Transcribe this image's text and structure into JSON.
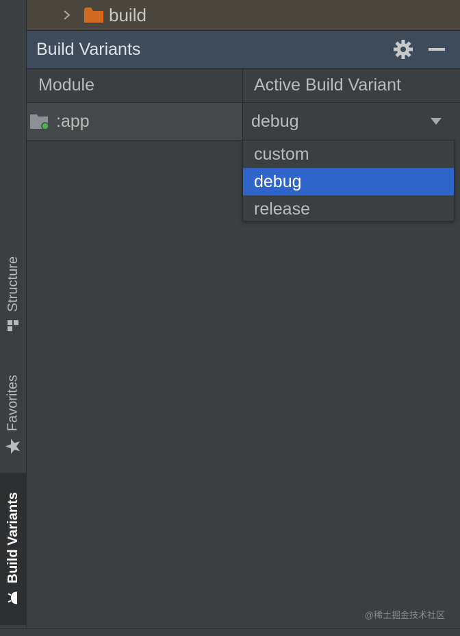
{
  "project_tree": {
    "folder_label": "build"
  },
  "panel": {
    "title": "Build Variants"
  },
  "table": {
    "columns": [
      "Module",
      "Active Build Variant"
    ],
    "rows": [
      {
        "module": ":app",
        "variant": "debug"
      }
    ]
  },
  "dropdown": {
    "options": [
      "custom",
      "debug",
      "release"
    ],
    "selected": "debug"
  },
  "side_tabs": {
    "structure": "Structure",
    "favorites": "Favorites",
    "build_variants": "Build Variants"
  },
  "watermark": "@稀土掘金技术社区",
  "colors": {
    "selection": "#2f65ca",
    "header": "#3d4b5b",
    "folder": "#d2691e",
    "status_dot": "#4caf50"
  }
}
